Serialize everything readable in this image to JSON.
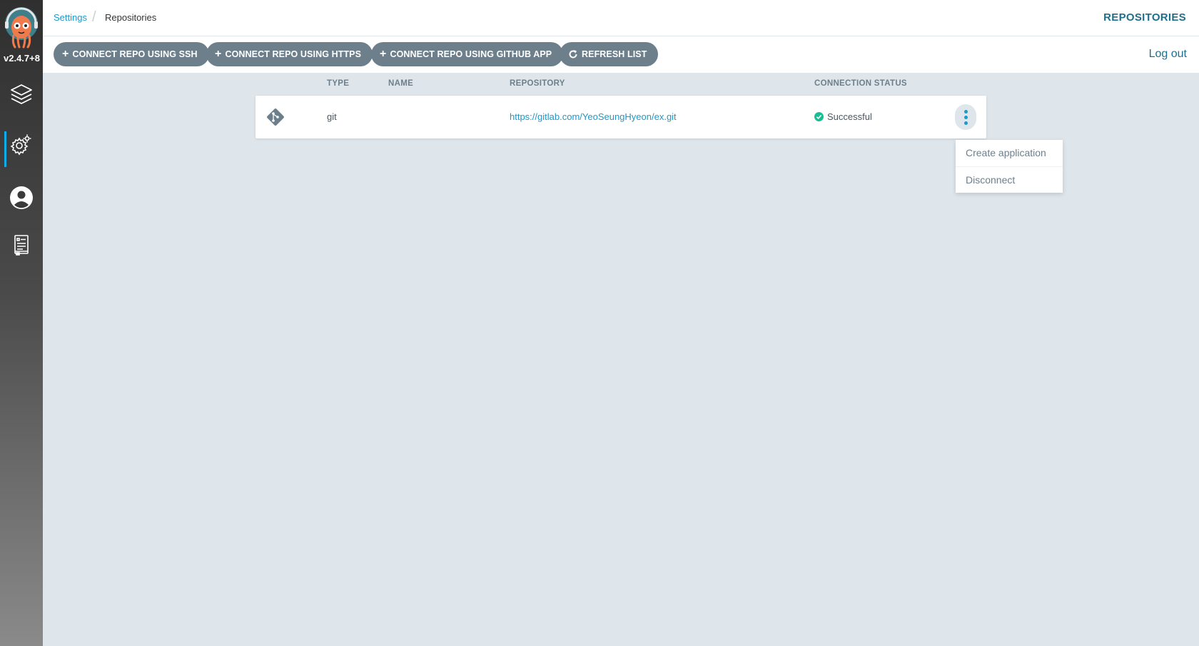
{
  "sidebar": {
    "version": "v2.4.7+8",
    "items": [
      {
        "icon": "layers-icon"
      },
      {
        "icon": "gear-icon",
        "active": true
      },
      {
        "icon": "user-icon"
      },
      {
        "icon": "docs-icon"
      }
    ]
  },
  "header": {
    "breadcrumb": [
      "Settings",
      "Repositories"
    ],
    "title": "REPOSITORIES"
  },
  "toolbar": {
    "buttons": [
      {
        "label": "CONNECT REPO USING SSH",
        "icon": "plus-icon"
      },
      {
        "label": "CONNECT REPO USING HTTPS",
        "icon": "plus-icon"
      },
      {
        "label": "CONNECT REPO USING GITHUB APP",
        "icon": "plus-icon"
      },
      {
        "label": "REFRESH LIST",
        "icon": "refresh-icon"
      }
    ],
    "logout": "Log out"
  },
  "table": {
    "columns": [
      "TYPE",
      "NAME",
      "REPOSITORY",
      "CONNECTION STATUS"
    ],
    "rows": [
      {
        "type": "git",
        "name": "",
        "repository": "https://gitlab.com/YeoSeungHyeon/ex.git",
        "status": "Successful"
      }
    ]
  },
  "menu": {
    "items": [
      "Create application",
      "Disconnect"
    ]
  },
  "colors": {
    "accent": "#1e98c7",
    "button": "#6d7f8b",
    "success": "#18be94"
  }
}
